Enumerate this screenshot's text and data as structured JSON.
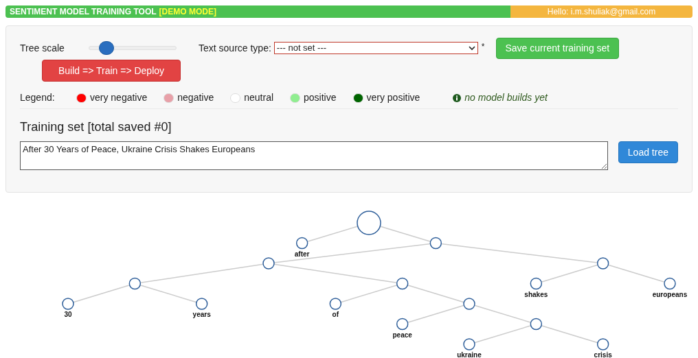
{
  "header": {
    "title": "SENTIMENT MODEL TRAINING TOOL",
    "mode": "[DEMO MODE]",
    "greeting": "Hello: i.m.shuliak@gmail.com"
  },
  "controls": {
    "tree_scale": {
      "label": "Tree scale",
      "level": 0.2
    },
    "build_button": "Build => Train => Deploy",
    "text_source": {
      "label": "Text source type:",
      "value": "--- not set ---",
      "required_mark": "*"
    },
    "save_button": "Save current training set"
  },
  "legend": {
    "label": "Legend:",
    "items": [
      {
        "label": "very negative",
        "color": "#ff0000"
      },
      {
        "label": "negative",
        "color": "#e8a0a8"
      },
      {
        "label": "neutral",
        "color": "#ffffff"
      },
      {
        "label": "positive",
        "color": "#90ee90"
      },
      {
        "label": "very positive",
        "color": "#006400"
      }
    ],
    "status": "no model builds yet"
  },
  "training_set": {
    "title": "Training set [total saved #0]",
    "text": "After 30 Years of Peace, Ukraine Crisis Shakes Europeans",
    "load_button": "Load tree"
  },
  "tree": {
    "children": [
      {
        "label": "after"
      },
      {
        "children": [
          {
            "children": [
              {
                "children": [
                  {
                    "label": "30"
                  },
                  {
                    "label": "years"
                  }
                ]
              },
              {
                "children": [
                  {
                    "label": "of"
                  },
                  {
                    "children": [
                      {
                        "label": "peace"
                      },
                      {
                        "children": [
                          {
                            "label": "ukraine"
                          },
                          {
                            "label": "crisis"
                          }
                        ]
                      }
                    ]
                  }
                ]
              }
            ]
          },
          {
            "children": [
              {
                "label": "shakes"
              },
              {
                "label": "europeans"
              }
            ]
          }
        ]
      }
    ]
  }
}
